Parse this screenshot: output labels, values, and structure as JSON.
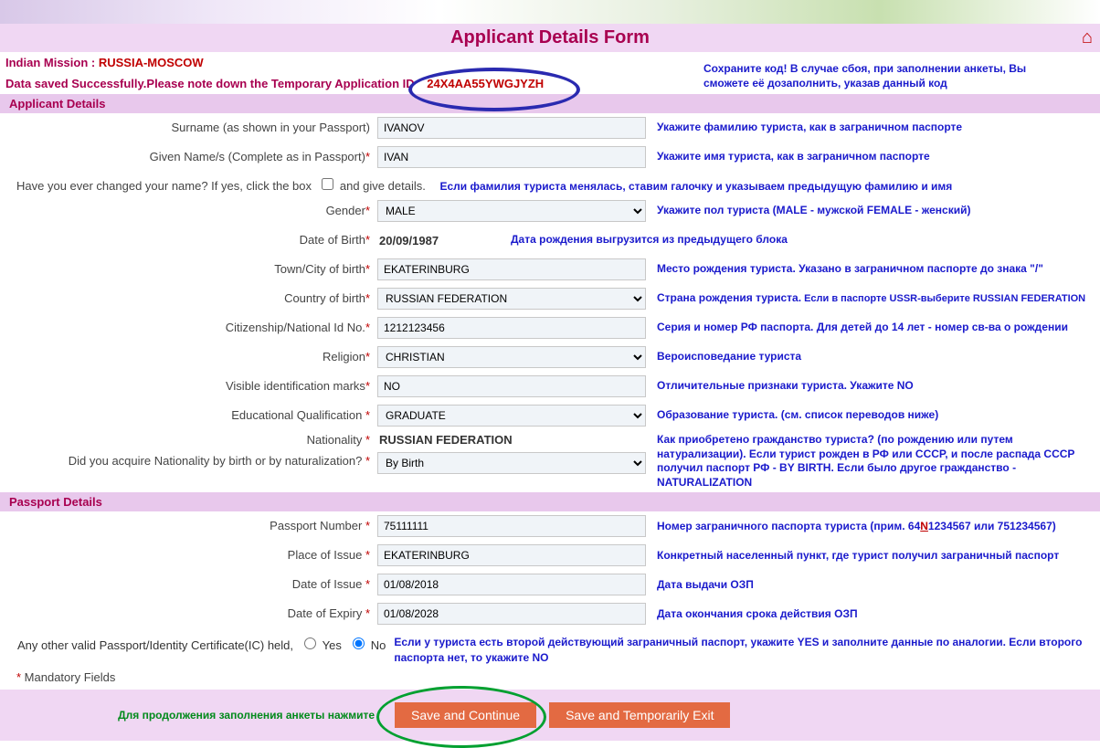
{
  "title": "Applicant Details Form",
  "mission_label": "Indian Mission : ",
  "mission_value": "RUSSIA-MOSCOW",
  "saved_msg": "Data saved Successfully.Please note down the Temporary Application ID",
  "app_id": "24X4AA55YWGJYZH",
  "save_code_hint": "Сохраните код! В случае сбоя, при заполнении анкеты, Вы сможете её дозаполнить, указав данный код",
  "sections": {
    "applicant": "Applicant Details",
    "passport": "Passport Details"
  },
  "applicant": {
    "surname_label": "Surname (as shown in your Passport)",
    "surname_value": "IVANOV",
    "surname_hint": "Укажите фамилию туриста, как в заграничном паспорте",
    "given_label": "Given Name/s (Complete as in Passport)",
    "given_value": "IVAN",
    "given_hint": "Укажите имя туриста, как в заграничном паспорте",
    "changed_name_label": "Have you ever changed your name? If yes, click the box",
    "changed_name_after": "and give details.",
    "changed_name_hint": "Если фамилия туриста менялась, ставим галочку и указываем предыдущую фамилию и имя",
    "gender_label": "Gender",
    "gender_value": "MALE",
    "gender_hint": "Укажите пол туриста (MALE - мужской FEMALE - женский)",
    "dob_label": "Date of Birth",
    "dob_value": "20/09/1987",
    "dob_hint": "Дата рождения выгрузится из предыдущего блока",
    "town_label": "Town/City of birth",
    "town_value": "EKATERINBURG",
    "town_hint": "Место рождения туриста. Указано в заграничном паспорте до знака \"/\"",
    "country_label": "Country of birth",
    "country_value": "RUSSIAN FEDERATION",
    "country_hint": "Страна рождения туриста.",
    "country_hint_sub": " Если в паспорте USSR-выберите RUSSIAN FEDERATION",
    "citizenship_label": "Citizenship/National Id No.",
    "citizenship_value": "1212123456",
    "citizenship_hint": "Серия и номер РФ паспорта. Для детей до 14 лет - номер св-ва о рождении",
    "religion_label": "Religion",
    "religion_value": "CHRISTIAN",
    "religion_hint": "Вероисповедание туриста",
    "marks_label": "Visible identification marks",
    "marks_value": "NO",
    "marks_hint": "Отличительные признаки туриста. Укажите NO",
    "edu_label": "Educational Qualification ",
    "edu_value": "GRADUATE",
    "edu_hint": "Образование туриста. (см. список переводов ниже)",
    "nationality_label": "Nationality ",
    "nationality_value": "RUSSIAN FEDERATION",
    "acquire_label": "Did you acquire Nationality by birth or by naturalization? ",
    "acquire_value": "By Birth",
    "acquire_hint": "Как приобретено гражданство туриста? (по рождению или путем натурализации). Если турист рожден в РФ или СССР, и после распада СССР получил паспорт РФ - BY BIRTH. Если было другое гражданство - NATURALIZATION"
  },
  "passport": {
    "number_label": "Passport Number ",
    "number_value": "75111111",
    "number_hint_a": "Номер заграничного паспорта туриста (прим. 64",
    "number_hint_b": "N",
    "number_hint_c": "1234567 или 751234567)",
    "place_label": "Place of Issue ",
    "place_value": "EKATERINBURG",
    "place_hint": "Конкретный населенный пункт, где турист получил заграничный паспорт",
    "issue_label": "Date of Issue ",
    "issue_value": "01/08/2018",
    "issue_hint": "Дата выдачи ОЗП",
    "expiry_label": "Date of Expiry ",
    "expiry_value": "01/08/2028",
    "expiry_hint": "Дата окончания срока действия ОЗП",
    "other_label": "Any other valid Passport/Identity Certificate(IC) held,",
    "yes": "Yes",
    "no": "No",
    "other_hint": "Если у туриста есть второй действующий заграничный паспорт, укажите YES и заполните данные по аналогии. Если второго паспорта нет, то укажите NO"
  },
  "mandatory": " Mandatory Fields",
  "continue_hint": "Для продолжения заполнения анкеты нажмите",
  "buttons": {
    "save_continue": "Save and Continue",
    "save_exit": "Save and Temporarily Exit"
  }
}
